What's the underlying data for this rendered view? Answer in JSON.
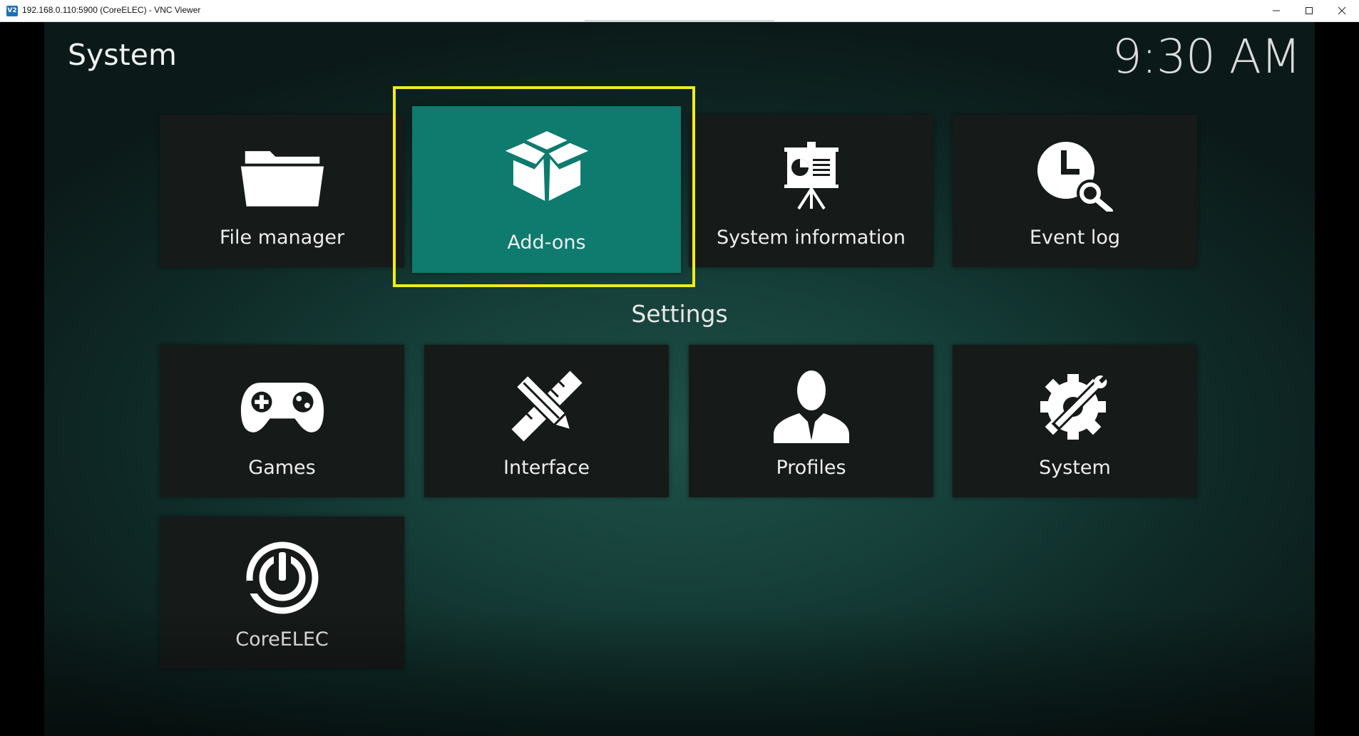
{
  "window": {
    "title": "192.168.0.110:5900 (CoreELEC) - VNC Viewer",
    "app_icon_text": "V2"
  },
  "kodi": {
    "page_title": "System",
    "clock": "9:30 AM",
    "section_label": "Settings",
    "tiles": [
      {
        "label": "File manager",
        "icon": "folder-icon"
      },
      {
        "label": "Add-ons",
        "icon": "box-icon",
        "focused": true
      },
      {
        "label": "System information",
        "icon": "presentation-icon"
      },
      {
        "label": "Event log",
        "icon": "clock-search-icon"
      },
      {
        "label": "Games",
        "icon": "gamepad-icon"
      },
      {
        "label": "Interface",
        "icon": "pencil-ruler-icon"
      },
      {
        "label": "Profiles",
        "icon": "user-icon"
      },
      {
        "label": "System",
        "icon": "gear-wrench-icon"
      },
      {
        "label": "CoreELEC",
        "icon": "power-icon"
      }
    ]
  },
  "colors": {
    "focus_tile": "#0e7b6e",
    "highlight_border": "#f0ec1a",
    "tile_bg": "#161a19"
  }
}
